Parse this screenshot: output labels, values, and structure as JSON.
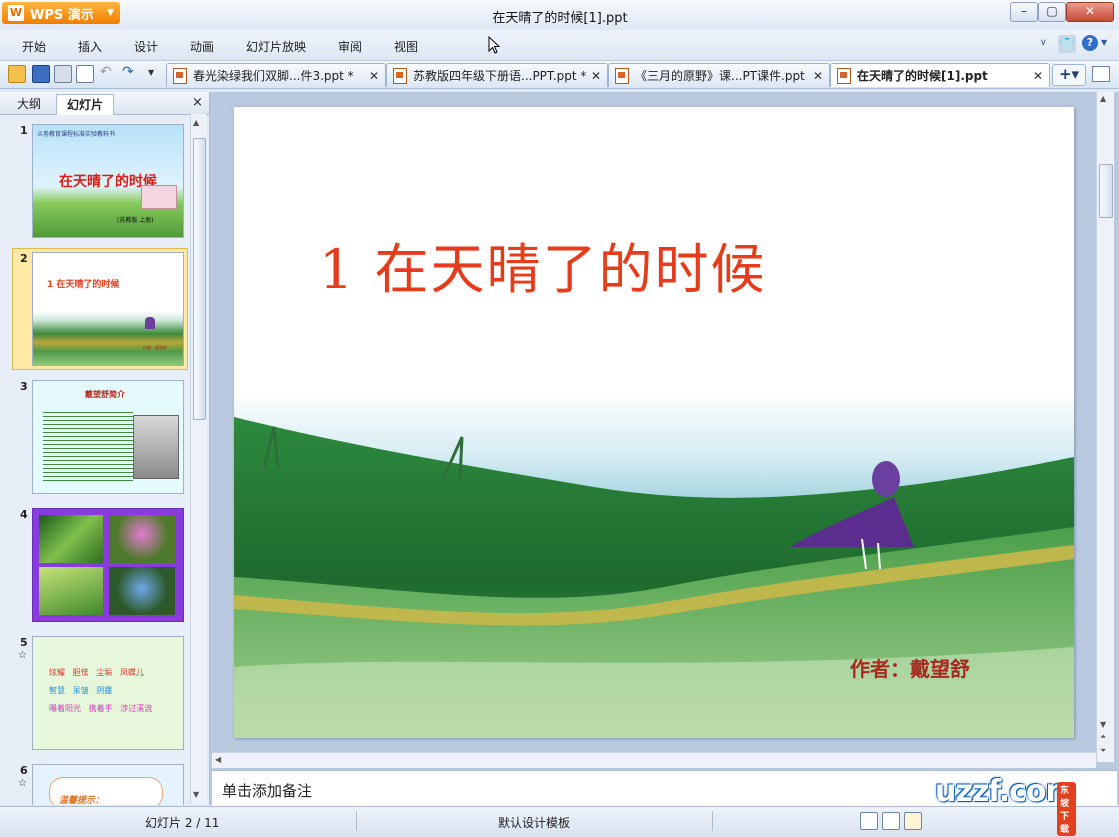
{
  "app": {
    "button_label": "WPS 演示",
    "logo_glyph": "W"
  },
  "window": {
    "title": "在天晴了的时候[1].ppt"
  },
  "menu": {
    "items": [
      "开始",
      "插入",
      "设计",
      "动画",
      "幻灯片放映",
      "审阅",
      "视图"
    ]
  },
  "tabs": [
    {
      "label": "春光染绿我们双脚...件3.ppt *"
    },
    {
      "label": "苏教版四年级下册语...PPT.ppt *"
    },
    {
      "label": "《三月的原野》课...PT课件.ppt"
    },
    {
      "label": "在天晴了的时候[1].ppt"
    }
  ],
  "panel": {
    "tab_outline": "大纲",
    "tab_slides": "幻灯片",
    "close": "×"
  },
  "thumbs": {
    "t1": {
      "num": "1",
      "header": "义务教育课程标准实验教科书",
      "title": "在天晴了的时候",
      "foot": "(苏教版 上册)"
    },
    "t2": {
      "num": "2",
      "title": "1  在天晴了的时候",
      "foot": "作者：戴望舒"
    },
    "t3": {
      "num": "3",
      "title": "戴望舒简介"
    },
    "t4": {
      "num": "4"
    },
    "t5": {
      "num": "5",
      "star": "☆",
      "words": [
        "炫耀",
        "胆怯",
        "尘垢",
        "凤蝶儿",
        "智慧",
        "呆皱",
        "阴霾",
        "曝着阳光",
        "携着手",
        "涉过溪流"
      ]
    },
    "t6": {
      "num": "6",
      "star": "☆",
      "title": "温馨提示："
    }
  },
  "slide": {
    "title": "1  在天晴了的时候",
    "author": "作者：戴望舒"
  },
  "notes": {
    "placeholder": "单击添加备注"
  },
  "status": {
    "slide_info": "幻灯片 2 / 11",
    "template": "默认设计模板"
  },
  "watermark": {
    "text": "uzzf.com",
    "sub": "东坡下载"
  },
  "colors": {
    "title_red": "#e53d1c",
    "author_red": "#a8281e",
    "wps_orange": "#ee7d00"
  }
}
